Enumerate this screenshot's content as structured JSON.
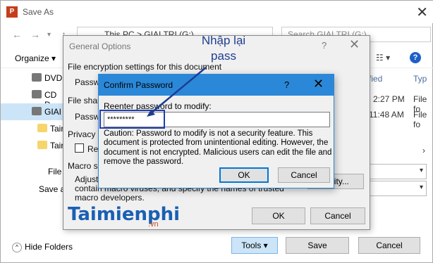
{
  "save_as": {
    "title": "Save As",
    "app_icon": "P",
    "address": "This PC > GIAI TRI (G:)",
    "search_placeholder": "Search GIAI TRI (G:)",
    "organize_label": "Organize",
    "sidebar": [
      {
        "label": "DVD",
        "icon": "dvd-drive-icon"
      },
      {
        "label": "CD D",
        "icon": "cd-drive-icon"
      },
      {
        "label": "GIAI",
        "icon": "drive-icon"
      },
      {
        "label": "Tair",
        "icon": "folder-icon"
      },
      {
        "label": "Tair",
        "icon": "folder-icon"
      }
    ],
    "columns": {
      "date_partial": "fied",
      "type_partial": "Typ"
    },
    "rows": [
      {
        "time": "2:27 PM",
        "type": "File fo"
      },
      {
        "time": "11:48 AM",
        "type": "File fo"
      }
    ],
    "file_label": "File",
    "saveas_label": "Save a",
    "save_side_text": "save",
    "security_partial": "curity...",
    "hide_folders_label": "Hide Folders",
    "tools_label": "Tools",
    "save_button": "Save",
    "cancel_button": "Cancel"
  },
  "general_options": {
    "title": "General Options",
    "help": "?",
    "close": "✕",
    "encrypt_heading": "File encryption settings for this document",
    "password_partial_1": "Passwo",
    "sharing_partial": "File shar",
    "password_partial_2": "Passwo",
    "privacy_partial": "Privacy o",
    "remove_partial": "Re",
    "macro_partial": "Macro s",
    "adjust_partial": "Adjust",
    "macro_line1": "contain macro viruses, and specify the names of trusted",
    "macro_line2": "macro developers.",
    "ok": "OK",
    "cancel": "Cancel"
  },
  "confirm_password": {
    "title": "Confirm Password",
    "help": "?",
    "close": "✕",
    "label": "Reenter password to modify:",
    "value": "*********",
    "caution": "Caution: Password to modify is not a security feature. This document is protected from unintentional editing. However, the document is not encrypted. Malicious users can edit the file and remove the password.",
    "ok": "OK",
    "cancel": "Cancel"
  },
  "annotation": {
    "line1": "Nhập lại",
    "line2": "pass",
    "color": "#1e3d91"
  },
  "watermark": {
    "brand": "Taimienphi",
    "suffix": ".vn"
  }
}
